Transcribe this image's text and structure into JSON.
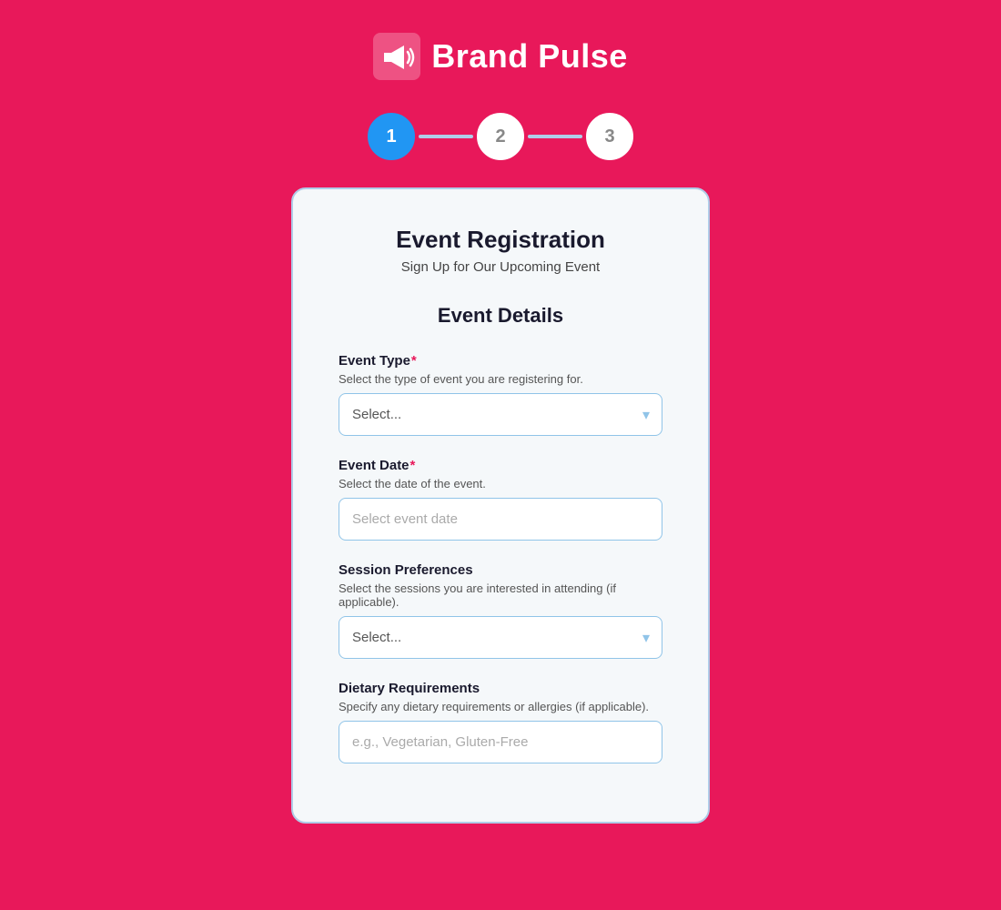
{
  "header": {
    "brand_name": "Brand Pulse"
  },
  "steps": [
    {
      "number": "1",
      "active": true
    },
    {
      "number": "2",
      "active": false
    },
    {
      "number": "3",
      "active": false
    }
  ],
  "form": {
    "title": "Event Registration",
    "subtitle": "Sign Up for Our Upcoming Event",
    "section_title": "Event Details",
    "fields": [
      {
        "id": "event_type",
        "label": "Event Type",
        "required": true,
        "description": "Select the type of event you are registering for.",
        "type": "select",
        "placeholder": "Select..."
      },
      {
        "id": "event_date",
        "label": "Event Date",
        "required": true,
        "description": "Select the date of the event.",
        "type": "date_input",
        "placeholder": "Select event date"
      },
      {
        "id": "session_preferences",
        "label": "Session Preferences",
        "required": false,
        "description": "Select the sessions you are interested in attending (if applicable).",
        "type": "select",
        "placeholder": "Select..."
      },
      {
        "id": "dietary_requirements",
        "label": "Dietary Requirements",
        "required": false,
        "description": "Specify any dietary requirements or allergies (if applicable).",
        "type": "text_input",
        "placeholder": "e.g., Vegetarian, Gluten-Free"
      }
    ]
  },
  "colors": {
    "bg": "#e8185a",
    "active_step": "#2196f3",
    "brand_text": "#ffffff"
  }
}
